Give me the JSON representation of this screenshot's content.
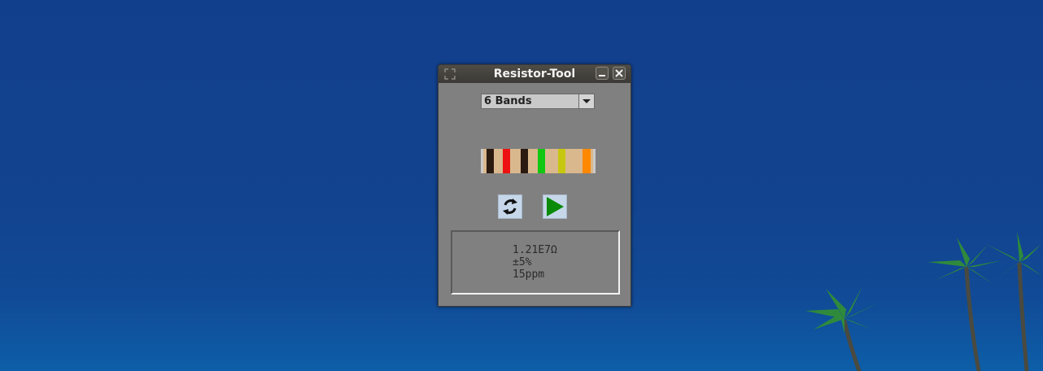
{
  "window": {
    "title": "Resistor-Tool"
  },
  "band_select": {
    "value": "6 Bands"
  },
  "resistor": {
    "band_colors": [
      "#2b1a10",
      "#ee1111",
      "#2b1a10",
      "#11c711",
      "#c7c711",
      "#ff8800"
    ]
  },
  "actions": {
    "refresh_icon": "refresh-icon",
    "play_icon": "play-icon"
  },
  "result": {
    "resistance": "1.21E7Ω",
    "tolerance": "±5%",
    "temp_coefficient": "15ppm"
  }
}
